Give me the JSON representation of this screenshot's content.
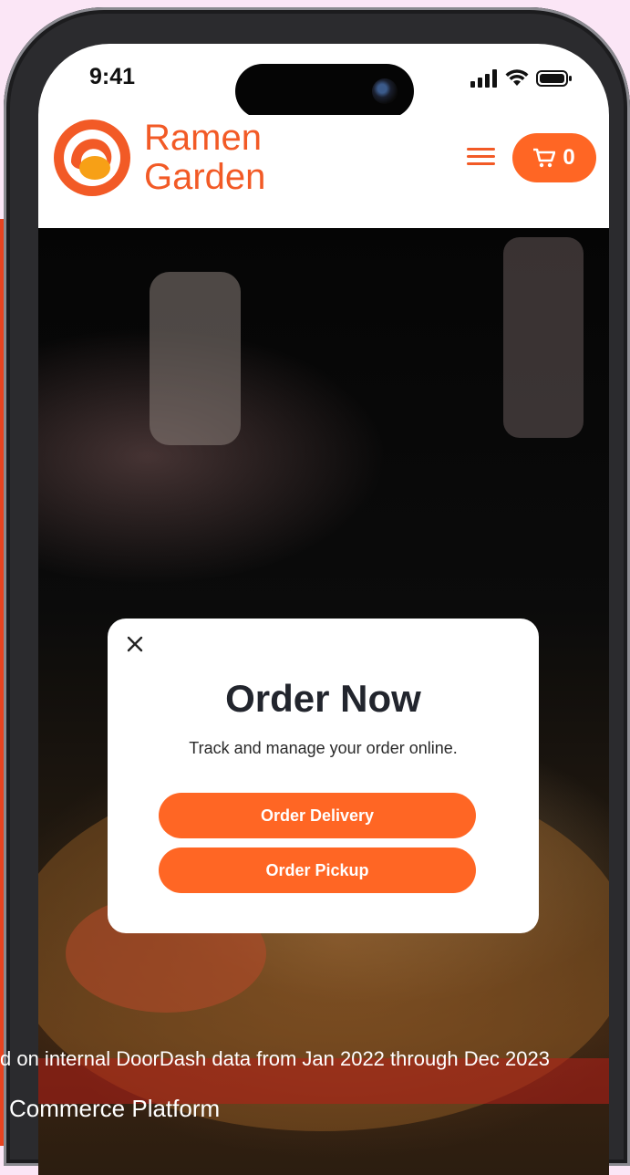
{
  "status_bar": {
    "time": "9:41"
  },
  "brand": {
    "line1": "Ramen",
    "line2": "Garden",
    "accent": "#f25a26"
  },
  "header": {
    "menu_icon": "hamburger-menu-icon",
    "cart_icon": "shopping-cart-icon",
    "cart_count": "0"
  },
  "modal": {
    "close_icon": "close-icon",
    "title": "Order Now",
    "subtitle": "Track and manage your order online.",
    "delivery_label": "Order Delivery",
    "pickup_label": "Order Pickup",
    "button_color": "#ff6624"
  },
  "background": {
    "caption": "d on internal DoorDash data from Jan 2022 through Dec 2023",
    "platform": "Commerce Platform",
    "accent": "#e8431f"
  }
}
